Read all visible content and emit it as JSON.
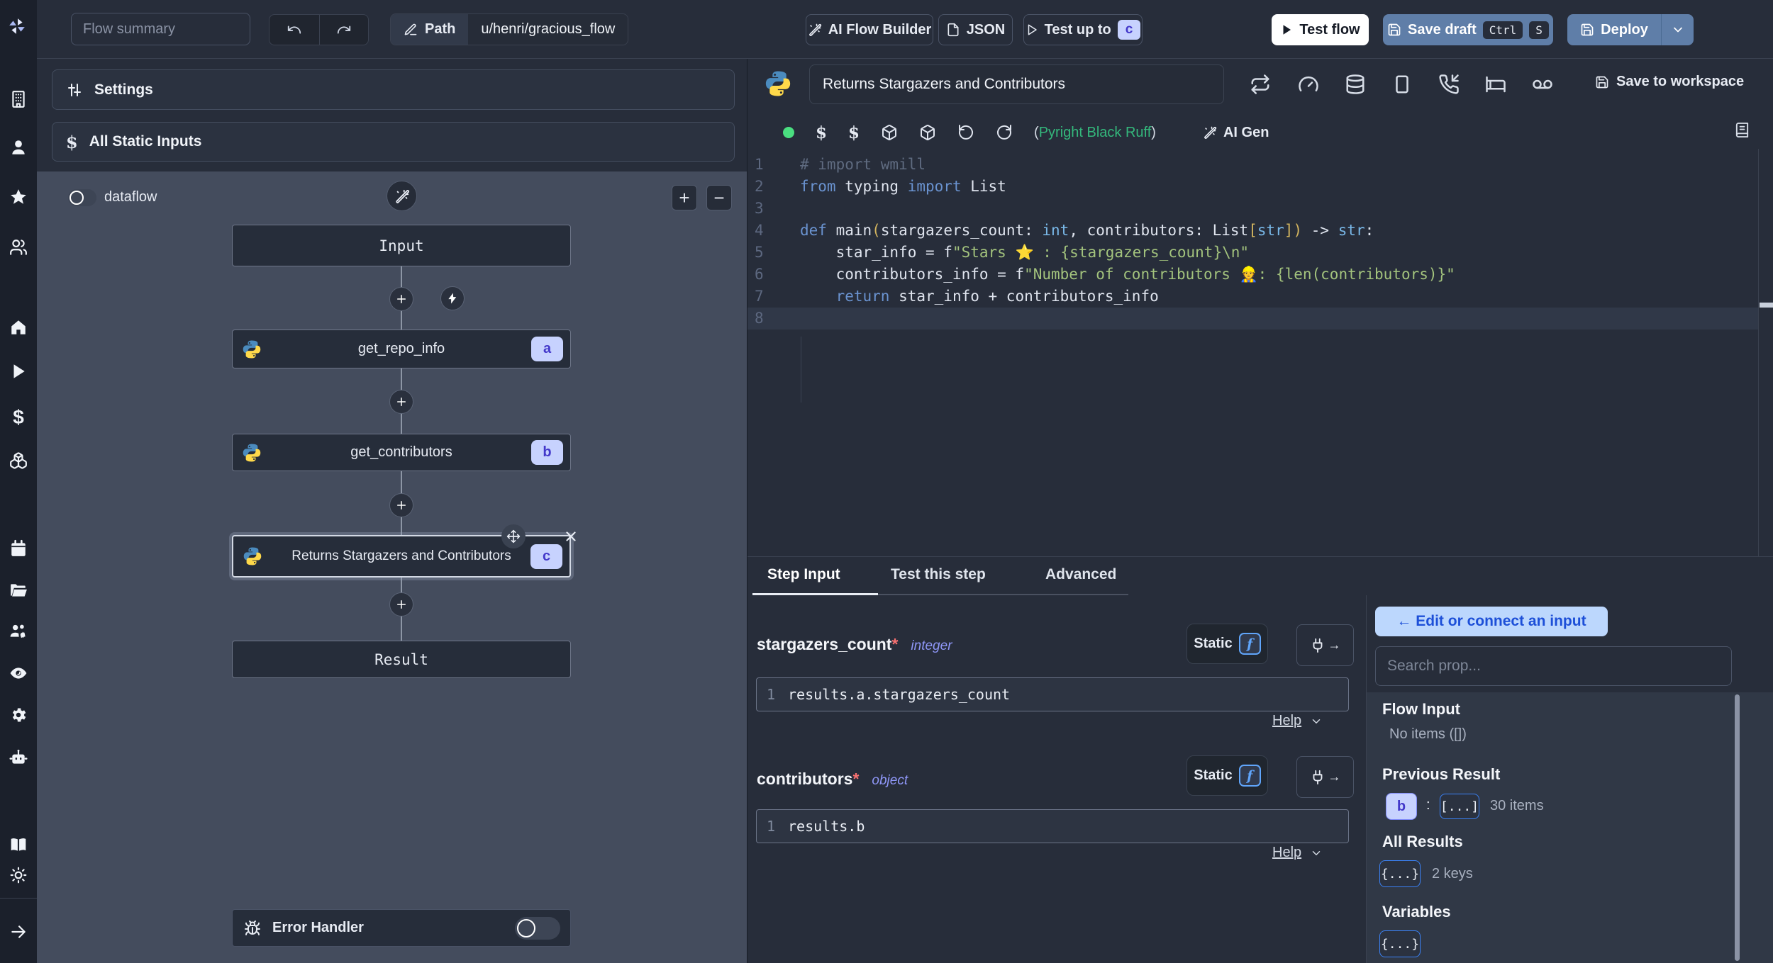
{
  "topbar": {
    "flow_summary_placeholder": "Flow summary",
    "path_label": "Path",
    "path_value": "u/henri/gracious_flow",
    "ai_flow_builder_label": "AI Flow Builder",
    "json_label": "JSON",
    "test_up_to_label": "Test up to",
    "test_up_to_badge": "c",
    "test_flow_label": "Test flow",
    "save_draft_label": "Save draft",
    "kbd_ctrl": "Ctrl",
    "kbd_s": "S",
    "deploy_label": "Deploy"
  },
  "sidebar": {
    "icons": [
      "windmill-logo",
      "building",
      "user",
      "star",
      "users",
      "home",
      "play",
      "dollar",
      "boxes",
      "calendar",
      "folder-open",
      "user-cog",
      "eye",
      "settings-gear",
      "bot",
      "book",
      "sun",
      "arrow-right"
    ],
    "dollar_glyph": "$"
  },
  "flow_panel": {
    "settings_label": "Settings",
    "static_inputs_label": "All Static Inputs",
    "static_inputs_icon": "$",
    "dataflow_label": "dataflow",
    "zoom_in_glyph": "+",
    "zoom_out_glyph": "−",
    "input_node_label": "Input",
    "result_node_label": "Result",
    "steps": [
      {
        "id": "a",
        "label": "get_repo_info"
      },
      {
        "id": "b",
        "label": "get_contributors"
      },
      {
        "id": "c",
        "label": "Returns Stargazers and Contributors"
      }
    ],
    "error_handler_label": "Error Handler"
  },
  "editor": {
    "title": "Returns Stargazers and Contributors",
    "save_to_workspace": "Save to workspace",
    "lint_open": "(",
    "lint_text": "Pyright Black Ruff",
    "lint_close": ")",
    "ai_gen_label": "AI Gen",
    "active_line": 8,
    "code_lines": [
      [
        [
          "comment",
          "# import wmill"
        ]
      ],
      [
        [
          "kw",
          "from"
        ],
        [
          "pl",
          " typing "
        ],
        [
          "kw",
          "import"
        ],
        [
          "pl",
          " List"
        ]
      ],
      [],
      [
        [
          "kw",
          "def"
        ],
        [
          "pl",
          " main"
        ],
        [
          "paren",
          "("
        ],
        [
          "pl",
          "stargazers_count: "
        ],
        [
          "type",
          "int"
        ],
        [
          "pl",
          ", contributors: List"
        ],
        [
          "paren",
          "["
        ],
        [
          "type",
          "str"
        ],
        [
          "paren",
          "]"
        ],
        [
          "paren",
          ")"
        ],
        [
          "pl",
          " -> "
        ],
        [
          "type",
          "str"
        ],
        [
          "pl",
          ":"
        ]
      ],
      [
        [
          "pl",
          "    star_info = f"
        ],
        [
          "str",
          "\"Stars ⭐ : {stargazers_count}\\n\""
        ]
      ],
      [
        [
          "pl",
          "    contributors_info = f"
        ],
        [
          "str",
          "\"Number of contributors 👷: {len(contributors)}\""
        ]
      ],
      [
        [
          "pl",
          "    "
        ],
        [
          "kw",
          "return"
        ],
        [
          "pl",
          " star_info + contributors_info"
        ]
      ],
      []
    ]
  },
  "step_panel": {
    "tabs": [
      {
        "label": "Step Input"
      },
      {
        "label": "Test this step"
      },
      {
        "label": "Advanced"
      }
    ],
    "fields": [
      {
        "name": "stargazers_count",
        "required": "*",
        "type": "integer",
        "mode": "Static",
        "fn_glyph": "f",
        "gutter": "1",
        "expr": "results.a.stargazers_count",
        "help_label": "Help"
      },
      {
        "name": "contributors",
        "required": "*",
        "type": "object",
        "mode": "Static",
        "fn_glyph": "f",
        "gutter": "1",
        "expr": "results.b",
        "help_label": "Help"
      }
    ]
  },
  "connect_panel": {
    "back_label": "← Edit or connect an input",
    "search_placeholder": "Search prop...",
    "flow_input": {
      "title": "Flow Input",
      "empty": "No items ([])"
    },
    "previous_result": {
      "title": "Previous Result",
      "badge": "b",
      "colon": ":",
      "items_badge": "[...]",
      "meta": "30 items"
    },
    "all_results": {
      "title": "All Results",
      "badge": "{...}",
      "meta": "2 keys"
    },
    "variables": {
      "title": "Variables",
      "badge": "{...}"
    }
  }
}
